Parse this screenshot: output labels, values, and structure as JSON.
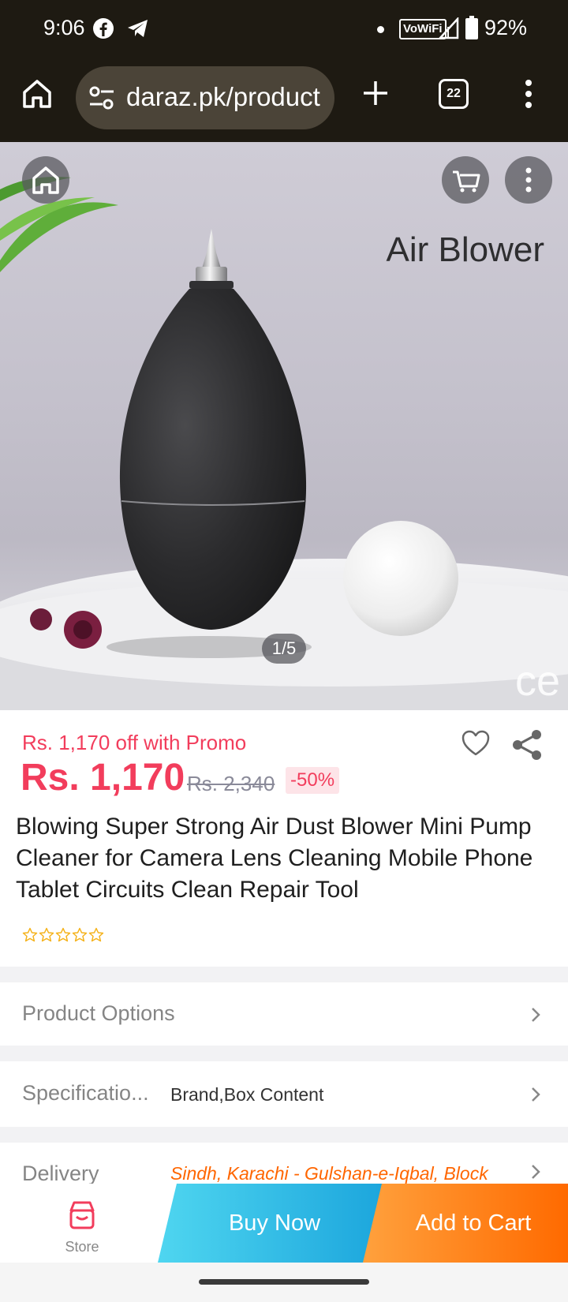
{
  "status_bar": {
    "time": "9:06",
    "network_badge": "VoWiFi",
    "battery": "92%",
    "icons": [
      "facebook-icon",
      "telegram-icon",
      "notification-dot-icon",
      "signal-icon",
      "battery-icon"
    ]
  },
  "browser": {
    "url": "daraz.pk/product",
    "tab_count": "22",
    "icons": [
      "home-icon",
      "site-settings-icon",
      "new-tab-icon",
      "tab-switcher-icon",
      "more-vert-icon"
    ]
  },
  "gallery": {
    "caption": "Air Blower",
    "counter": "1/5",
    "watermark": "ce",
    "icons": [
      "home-icon",
      "cart-icon",
      "more-vert-icon"
    ]
  },
  "product": {
    "promo": "Rs. 1,170 off with Promo",
    "price": "Rs. 1,170",
    "original_price": "Rs. 2,340",
    "discount": "-50%",
    "title": "Blowing Super Strong Air Dust Blower Mini Pump Cleaner for Camera Lens Cleaning Mobile Phone Tablet Circuits Clean Repair Tool",
    "rating_stars": 0,
    "rating_max": 5
  },
  "sections": {
    "options_label": "Product Options",
    "specs_label": "Specificatio...",
    "specs_value": "Brand,Box Content",
    "delivery_label": "Delivery",
    "delivery_value": "Sindh, Karachi - Gulshan-e-Iqbal, Block"
  },
  "bottom_bar": {
    "store_label": "Store",
    "buy_now": "Buy Now",
    "add_to_cart": "Add to Cart"
  },
  "colors": {
    "price_red": "#f23d5c",
    "buy_now_blue": "#1aa4dc",
    "add_cart_orange": "#ff6a00",
    "browser_chrome": "#1e1a12"
  }
}
